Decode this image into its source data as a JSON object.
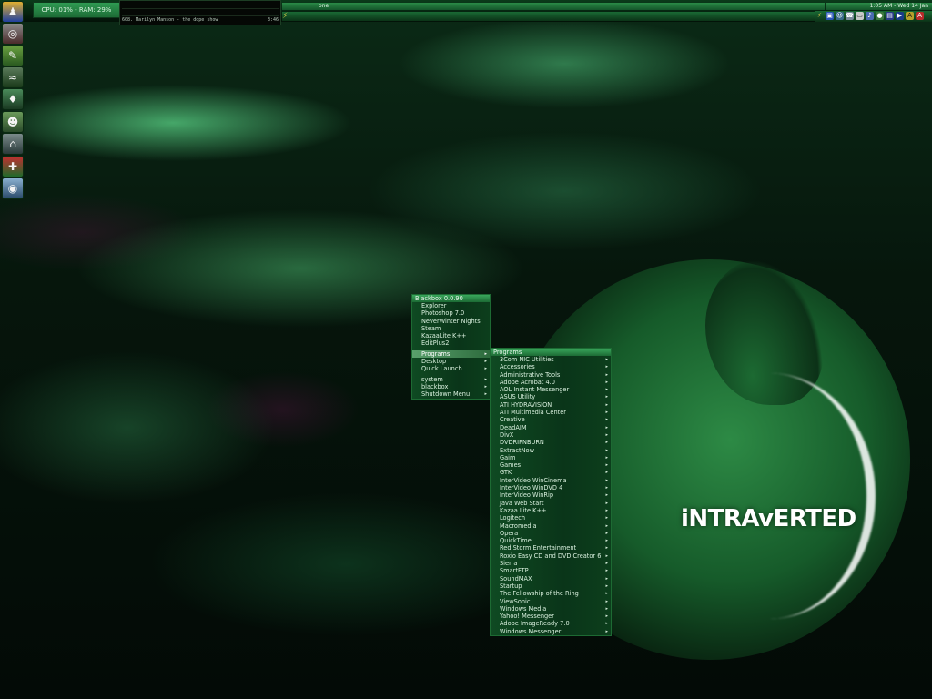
{
  "topbar": {
    "cpu_ram": "CPU: 01% - RAM: 29%",
    "workspace": "one",
    "clock": "1:05 AM - Wed 14 Jan"
  },
  "winamp": {
    "now_playing": "608. Marilyn Manson - the dope show",
    "time": "3:46"
  },
  "brand": "iNTRAvERTED",
  "blackbox_menu": {
    "title": "Blackbox 0.0.90",
    "items": [
      "Explorer",
      "Photoshop 7.0",
      "NeverWinter Nights",
      "Steam",
      "KazaaLite K++",
      "EditPlus2"
    ],
    "submenus": [
      "Programs",
      "Desktop",
      "Quick Launch"
    ],
    "submenus2": [
      "system",
      "blackbox",
      "Shutdown Menu"
    ]
  },
  "programs_menu": {
    "title": "Programs",
    "items": [
      "3Com NIC Utilities",
      "Accessories",
      "Administrative Tools",
      "Adobe Acrobat 4.0",
      "AOL Instant Messenger",
      "ASUS Utility",
      "ATI HYDRAVISION",
      "ATI Multimedia Center",
      "Creative",
      "DeadAIM",
      "DivX",
      "DVDRIPNBURN",
      "ExtractNow",
      "Gaim",
      "Games",
      "GTK",
      "InterVideo WinCinema",
      "InterVideo WinDVD 4",
      "InterVideo WinRip",
      "Java Web Start",
      "Kazaa Lite K++",
      "Logitech",
      "Macromedia",
      "Opera",
      "QuickTime",
      "Red Storm Entertainment",
      "Roxio Easy CD and DVD Creator 6",
      "Sierra",
      "SmartFTP",
      "SoundMAX",
      "Startup",
      "The Fellowship of the Ring",
      "ViewSonic",
      "Windows Media",
      "Yahoo! Messenger",
      "Adobe ImageReady 7.0",
      "Windows Messenger"
    ]
  },
  "dock_icons": [
    "blackbox-icon",
    "headphones-icon",
    "photoshop-icon",
    "steam-icon",
    "gaim-icon",
    "alien-icon",
    "ftp-icon",
    "kazaa-icon",
    "winamp-icon"
  ],
  "colors": {
    "accent": "#2f9a52",
    "menu_bg": "#0a3519",
    "highlight": "#5aa06c"
  }
}
